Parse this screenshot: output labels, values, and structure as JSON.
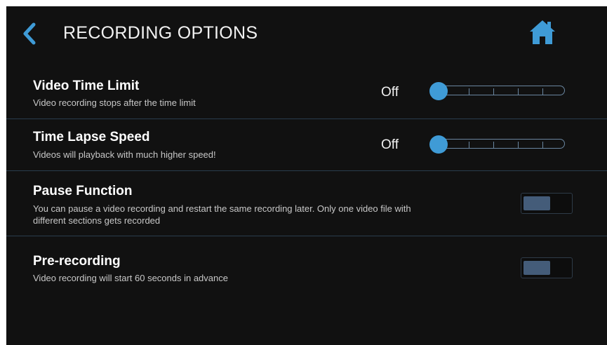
{
  "header": {
    "title": "RECORDING OPTIONS",
    "back_icon": "chevron-left-icon",
    "home_icon": "home-icon",
    "accent_color": "#3f9bd6"
  },
  "settings": [
    {
      "title": "Video Time Limit",
      "description": "Video recording stops after the time limit",
      "value": "Off",
      "control": "slider",
      "slider_position": 0
    },
    {
      "title": "Time Lapse Speed",
      "description": "Videos will playback with much higher speed!",
      "value": "Off",
      "control": "slider",
      "slider_position": 0
    },
    {
      "title": "Pause Function",
      "description": "You can pause a video recording and restart the same recording later. Only one video file with different sections gets recorded",
      "control": "toggle",
      "state": "off"
    },
    {
      "title": "Pre-recording",
      "description": "Video recording will start 60 seconds in advance",
      "control": "toggle",
      "state": "off"
    }
  ]
}
